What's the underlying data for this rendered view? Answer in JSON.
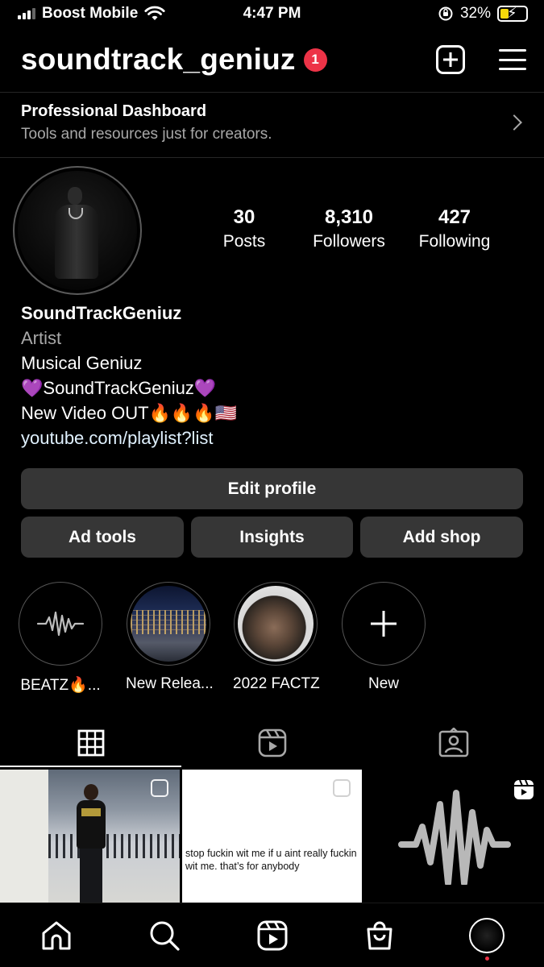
{
  "status_bar": {
    "carrier": "Boost Mobile",
    "time": "4:47 PM",
    "battery_percent": "32%",
    "battery_level": 0.32
  },
  "header": {
    "username": "soundtrack_geniuz",
    "notification_count": "1"
  },
  "dashboard": {
    "title": "Professional Dashboard",
    "subtitle": "Tools and resources just for creators."
  },
  "stats": {
    "posts_count": "30",
    "posts_label": "Posts",
    "followers_count": "8,310",
    "followers_label": "Followers",
    "following_count": "427",
    "following_label": "Following"
  },
  "bio": {
    "name": "SoundTrackGeniuz",
    "category": "Artist",
    "line1": "Musical Geniuz",
    "line2": "💜SoundTrackGeniuz💜",
    "line3": "New Video OUT🔥🔥🔥🇺🇸",
    "link": "youtube.com/playlist?list"
  },
  "buttons": {
    "edit_profile": "Edit profile",
    "ad_tools": "Ad tools",
    "insights": "Insights",
    "add_shop": "Add shop"
  },
  "highlights": [
    {
      "label": "BEATZ🔥..."
    },
    {
      "label": "New Relea..."
    },
    {
      "label": "2022 FACTZ"
    },
    {
      "label": "New"
    }
  ],
  "posts": [
    {
      "type": "photo"
    },
    {
      "type": "text",
      "text": "stop fuckin wit me if u aint really fuckin wit me. that’s for anybody"
    },
    {
      "type": "reel"
    }
  ],
  "colors": {
    "background": "#000000",
    "button": "#363636",
    "badge": "#ed3347",
    "secondary_text": "#a8a8a8",
    "link": "#e0f1ff"
  },
  "icons": {
    "header": [
      "add-post-icon",
      "menu-icon"
    ],
    "tabs": [
      "grid-icon",
      "reels-icon",
      "tagged-icon"
    ],
    "nav": [
      "home-icon",
      "search-icon",
      "reels-icon",
      "shop-icon",
      "profile-avatar"
    ]
  }
}
